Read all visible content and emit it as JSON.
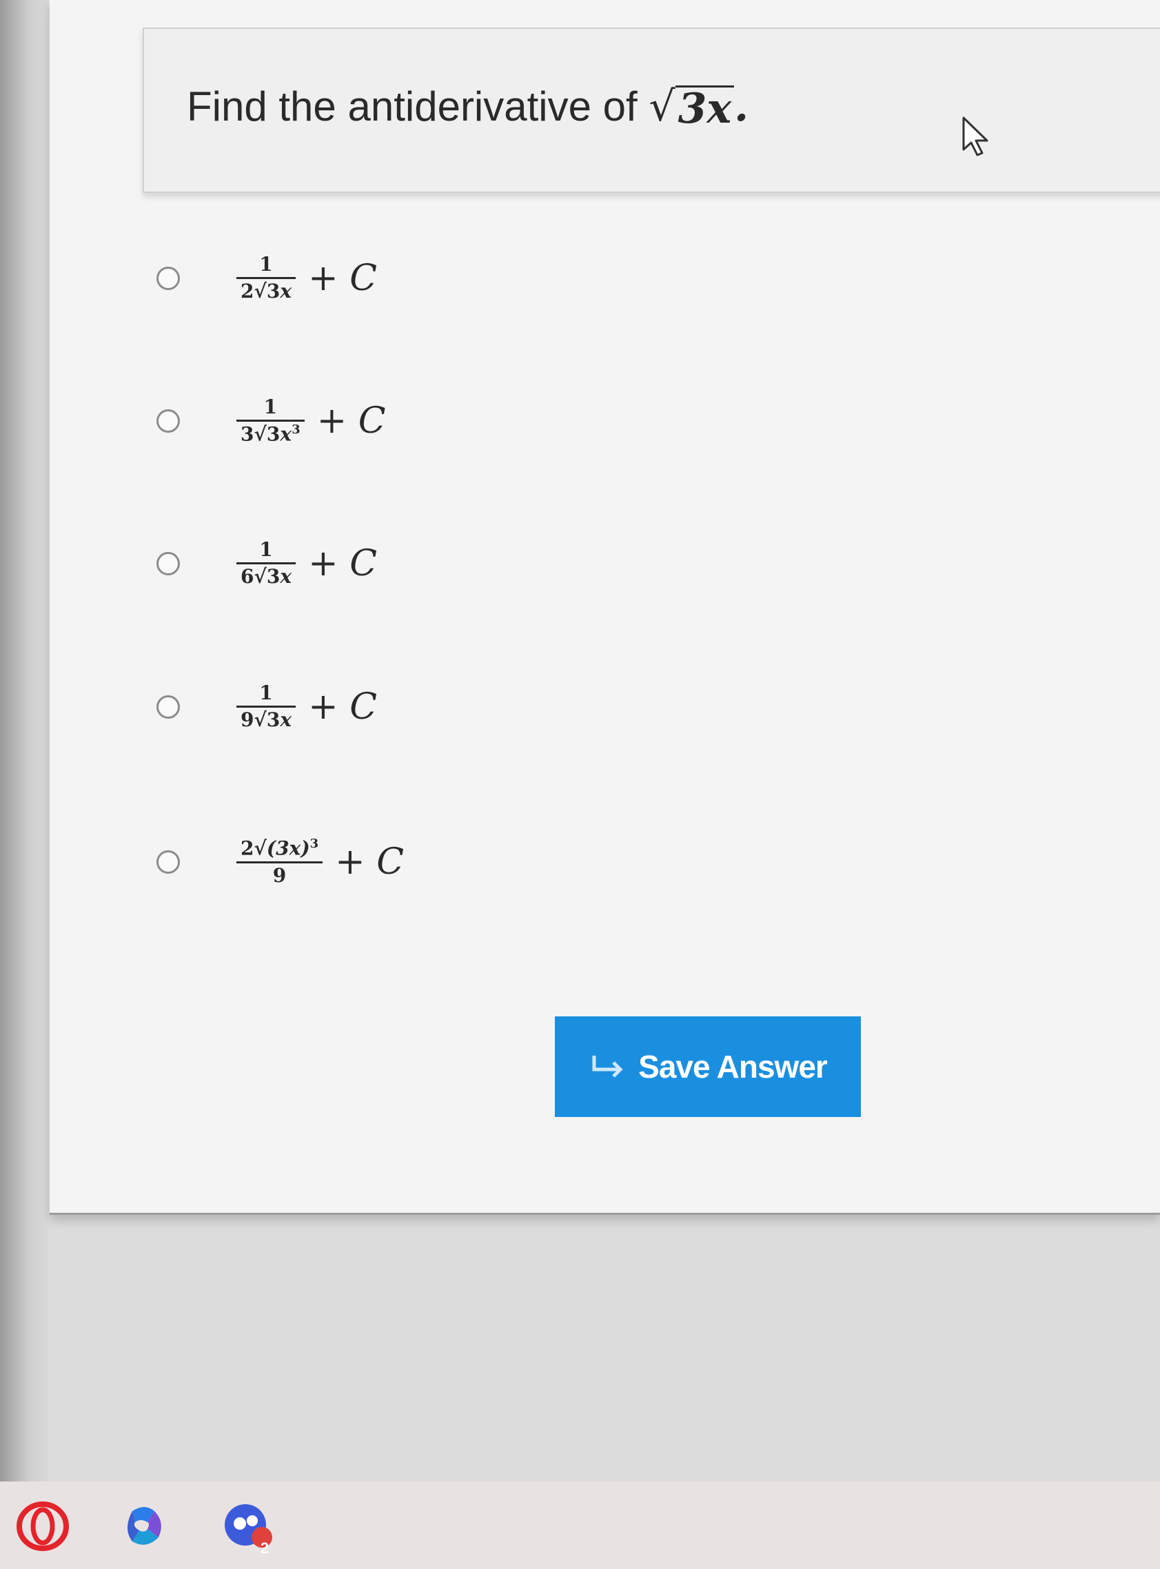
{
  "question": {
    "prefix": "Find the antiderivative of ",
    "radicand": "3x",
    "suffix": "."
  },
  "options": [
    {
      "coef": "2",
      "radicand": "3",
      "var": "x",
      "exp": "",
      "num": "1",
      "plus_c": "+ ",
      "c": "C"
    },
    {
      "coef": "3",
      "radicand": "3",
      "var": "x",
      "exp": "3",
      "num": "1",
      "plus_c": "+ ",
      "c": "C"
    },
    {
      "coef": "6",
      "radicand": "3",
      "var": "x",
      "exp": "",
      "num": "1",
      "plus_c": "+ ",
      "c": "C"
    },
    {
      "coef": "9",
      "radicand": "3",
      "var": "x",
      "exp": "",
      "num": "1",
      "plus_c": "+ ",
      "c": "C"
    },
    {
      "coef": "2",
      "radicand": "(3x)",
      "exp": "3",
      "den": "9",
      "plus_c": "+ ",
      "c": "C"
    }
  ],
  "save_button": {
    "label": "Save Answer",
    "icon": "return-arrow-icon"
  },
  "taskbar": {
    "icons": [
      "opera-icon",
      "copilot-icon",
      "chat-icon"
    ],
    "chat_badge": "2"
  },
  "colors": {
    "button": "#1a8fe0",
    "badge": "#e1413c"
  }
}
